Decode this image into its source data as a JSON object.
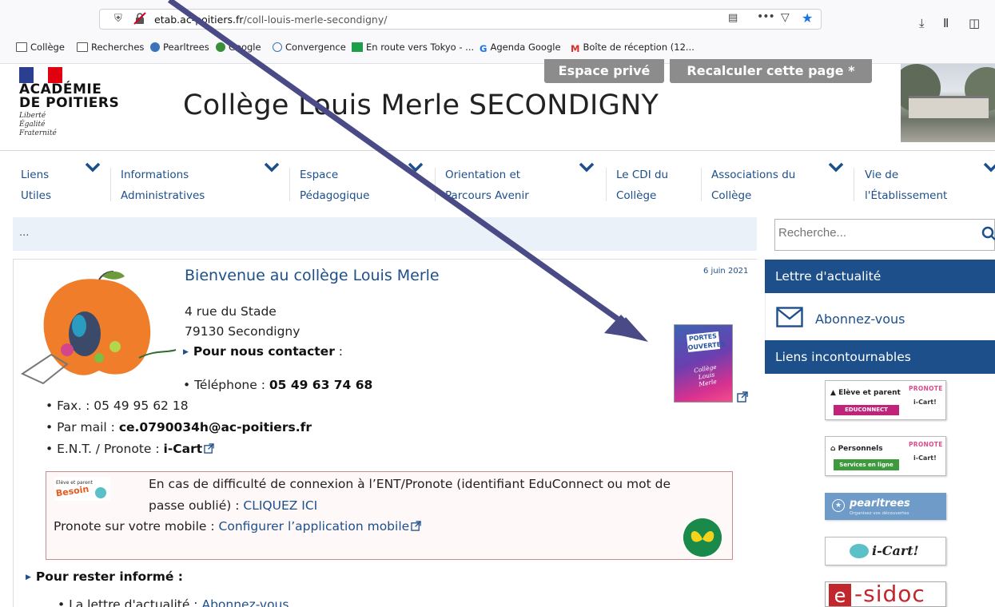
{
  "browser": {
    "url_domain": "etab.ac-poitiers.fr",
    "url_path": "/coll-louis-merle-secondigny/",
    "bookmarks": [
      "Collège",
      "Recherches",
      "Pearltrees",
      "Google",
      "Convergence",
      "En route vers Tokyo - ...",
      "Agenda Google",
      "Boîte de réception (12..."
    ]
  },
  "logo": {
    "line1": "ACADÉMIE",
    "line2": "DE POITIERS",
    "motto1": "Liberté",
    "motto2": "Égalité",
    "motto3": "Fraternité"
  },
  "header": {
    "title": "Collège Louis Merle SECONDIGNY",
    "btn_prive": "Espace privé",
    "btn_recalc": "Recalculer cette page *"
  },
  "nav": [
    {
      "l1": "Liens",
      "l2": "Utiles"
    },
    {
      "l1": "Informations",
      "l2": "Administratives"
    },
    {
      "l1": "Espace",
      "l2": "Pédagogique"
    },
    {
      "l1": "Orientation et",
      "l2": "Parcours Avenir"
    },
    {
      "l1": "Le CDI du",
      "l2": "Collège"
    },
    {
      "l1": "Associations du",
      "l2": "Collège"
    },
    {
      "l1": "Vie de",
      "l2": "l'Établissement"
    }
  ],
  "breadcrumb": "...",
  "search": {
    "placeholder": "Recherche..."
  },
  "post": {
    "title": "Bienvenue au collège Louis Merle",
    "date": "6 juin 2021",
    "address1": "4 rue du Stade",
    "address2": "79130 Secondigny",
    "contact_label": "Pour nous contacter",
    "contact_colon": " :",
    "phone_label": "Téléphone : ",
    "phone": "05 49 63 74 68",
    "fax": "Fax. : 05 49 95 62 18",
    "mail_label": "Par mail : ",
    "mail": "ce.0790034h@ac-poitiers.fr",
    "ent_label": "E.N.T. / Pronote : ",
    "ent_link": "i-Cart",
    "poster_top": "PORTES OUVERTES",
    "poster_caption": "Collège Louis Merle",
    "help_line1": "En cas de difficulté de connexion à l’ENT/Pronote (identifiant EduConnect ou mot de",
    "help_line2_prefix": "passe oublié) : ",
    "help_line2_link": "CLIQUEZ ICI",
    "help_line3_prefix": "Pronote sur votre mobile : ",
    "help_line3_link": "Configurer l’application mobile",
    "section": "Pour rester informé :",
    "cut_line_prefix": "La lettre d'actualité : ",
    "cut_line_link": "Abonnez-vous"
  },
  "sidebar": {
    "newsletter_title": "Lettre d'actualité",
    "subscribe": "Abonnez-vous",
    "links_title": "Liens incontournables",
    "badge1_title": "Elève et parent",
    "badge1_sub": "EDUCONNECT",
    "badge2_title": "Personnels",
    "badge2_sub": "Services en ligne",
    "pronote": "PRONOTE",
    "icart": "i-Cart!",
    "pearltrees": "pearltrees",
    "pearltrees_sub": "Organisez vos découvertes",
    "esidoc": "e-sidoc"
  },
  "colors": {
    "brand_blue": "#1d4f8a",
    "grey_button": "#8c8c8c",
    "annotation_arrow": "#4a4a86"
  }
}
